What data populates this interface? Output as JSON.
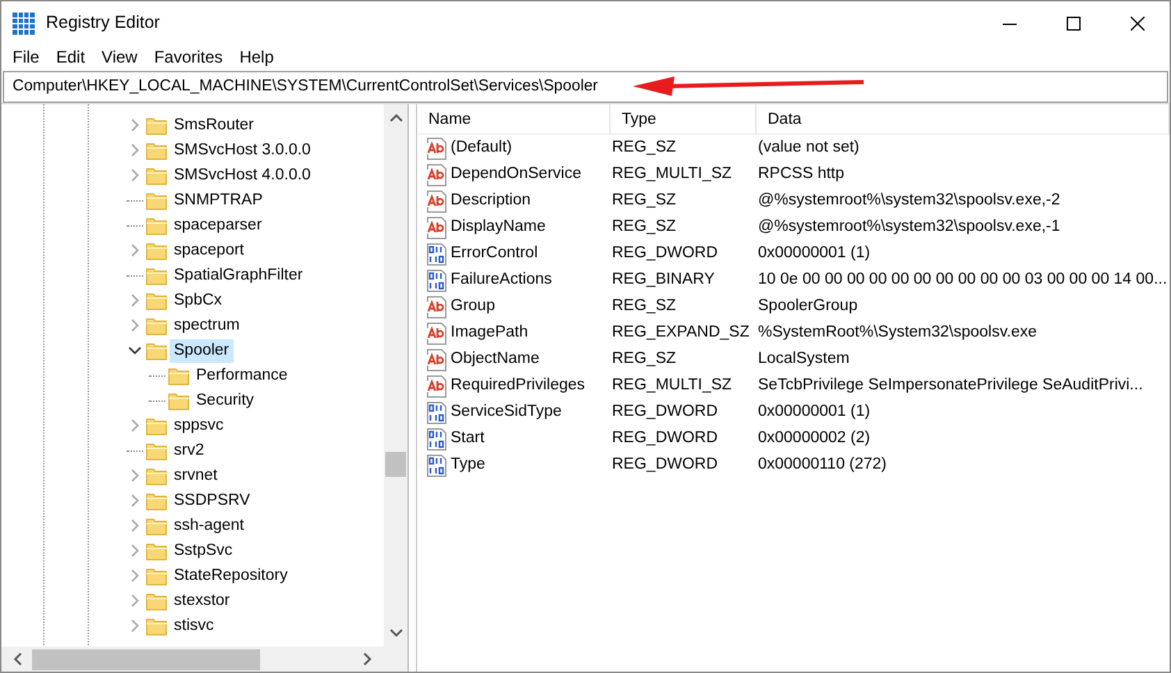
{
  "window": {
    "title": "Registry Editor"
  },
  "menu": [
    "File",
    "Edit",
    "View",
    "Favorites",
    "Help"
  ],
  "address": "Computer\\HKEY_LOCAL_MACHINE\\SYSTEM\\CurrentControlSet\\Services\\Spooler",
  "tree": [
    {
      "label": "SmsRouter",
      "kind": "expandable",
      "expanded": false,
      "selected": false
    },
    {
      "label": "SMSvcHost 3.0.0.0",
      "kind": "expandable",
      "expanded": false,
      "selected": false
    },
    {
      "label": "SMSvcHost 4.0.0.0",
      "kind": "expandable",
      "expanded": false,
      "selected": false
    },
    {
      "label": "SNMPTRAP",
      "kind": "leaf",
      "selected": false
    },
    {
      "label": "spaceparser",
      "kind": "leaf",
      "selected": false
    },
    {
      "label": "spaceport",
      "kind": "expandable",
      "expanded": false,
      "selected": false
    },
    {
      "label": "SpatialGraphFilter",
      "kind": "leaf",
      "selected": false
    },
    {
      "label": "SpbCx",
      "kind": "expandable",
      "expanded": false,
      "selected": false
    },
    {
      "label": "spectrum",
      "kind": "expandable",
      "expanded": false,
      "selected": false
    },
    {
      "label": "Spooler",
      "kind": "expandable",
      "expanded": true,
      "selected": true,
      "children": [
        {
          "label": "Performance",
          "kind": "leaf",
          "selected": false
        },
        {
          "label": "Security",
          "kind": "leaf",
          "selected": false
        }
      ]
    },
    {
      "label": "sppsvc",
      "kind": "expandable",
      "expanded": false,
      "selected": false
    },
    {
      "label": "srv2",
      "kind": "leaf",
      "selected": false
    },
    {
      "label": "srvnet",
      "kind": "expandable",
      "expanded": false,
      "selected": false
    },
    {
      "label": "SSDPSRV",
      "kind": "expandable",
      "expanded": false,
      "selected": false
    },
    {
      "label": "ssh-agent",
      "kind": "expandable",
      "expanded": false,
      "selected": false
    },
    {
      "label": "SstpSvc",
      "kind": "expandable",
      "expanded": false,
      "selected": false
    },
    {
      "label": "StateRepository",
      "kind": "expandable",
      "expanded": false,
      "selected": false
    },
    {
      "label": "stexstor",
      "kind": "expandable",
      "expanded": false,
      "selected": false
    },
    {
      "label": "stisvc",
      "kind": "expandable",
      "expanded": false,
      "selected": false
    }
  ],
  "table": {
    "columns": [
      "Name",
      "Type",
      "Data"
    ],
    "rows": [
      {
        "kind": "string",
        "name": "(Default)",
        "type": "REG_SZ",
        "data": "(value not set)"
      },
      {
        "kind": "string",
        "name": "DependOnService",
        "type": "REG_MULTI_SZ",
        "data": "RPCSS http"
      },
      {
        "kind": "string",
        "name": "Description",
        "type": "REG_SZ",
        "data": "@%systemroot%\\system32\\spoolsv.exe,-2"
      },
      {
        "kind": "string",
        "name": "DisplayName",
        "type": "REG_SZ",
        "data": "@%systemroot%\\system32\\spoolsv.exe,-1"
      },
      {
        "kind": "binary",
        "name": "ErrorControl",
        "type": "REG_DWORD",
        "data": "0x00000001 (1)"
      },
      {
        "kind": "binary",
        "name": "FailureActions",
        "type": "REG_BINARY",
        "data": "10 0e 00 00 00 00 00 00 00 00 00 00 03 00 00 00 14 00..."
      },
      {
        "kind": "string",
        "name": "Group",
        "type": "REG_SZ",
        "data": "SpoolerGroup"
      },
      {
        "kind": "string",
        "name": "ImagePath",
        "type": "REG_EXPAND_SZ",
        "data": "%SystemRoot%\\System32\\spoolsv.exe"
      },
      {
        "kind": "string",
        "name": "ObjectName",
        "type": "REG_SZ",
        "data": "LocalSystem"
      },
      {
        "kind": "string",
        "name": "RequiredPrivileges",
        "type": "REG_MULTI_SZ",
        "data": "SeTcbPrivilege SeImpersonatePrivilege SeAuditPrivi..."
      },
      {
        "kind": "binary",
        "name": "ServiceSidType",
        "type": "REG_DWORD",
        "data": "0x00000001 (1)"
      },
      {
        "kind": "binary",
        "name": "Start",
        "type": "REG_DWORD",
        "data": "0x00000002 (2)"
      },
      {
        "kind": "binary",
        "name": "Type",
        "type": "REG_DWORD",
        "data": "0x00000110 (272)"
      }
    ]
  }
}
